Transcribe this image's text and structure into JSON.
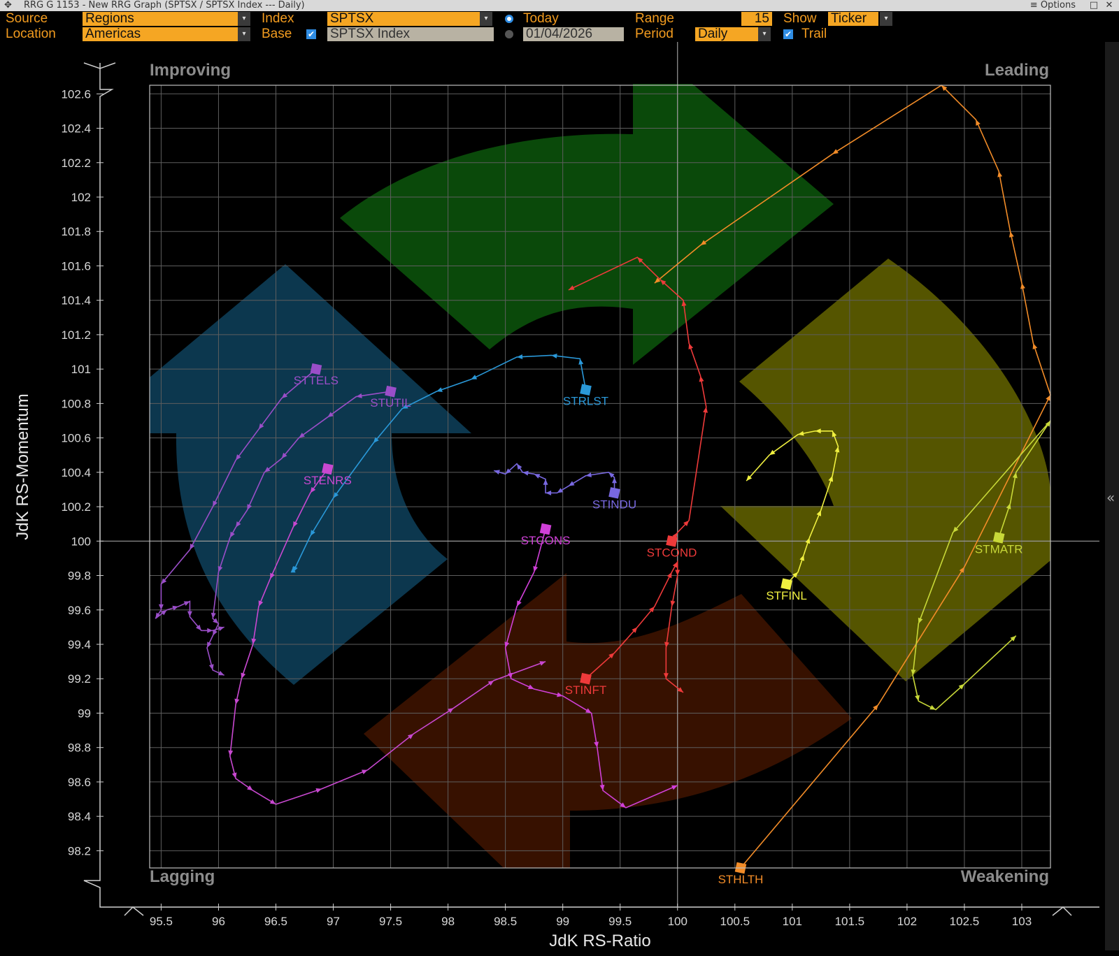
{
  "window": {
    "title": "RRG G 1153 - New RRG Graph (SPTSX / SPTSX Index --- Daily)",
    "options_label": "Options",
    "maximize_glyph": "□",
    "close_glyph": "✕"
  },
  "toolbar": {
    "source_label": "Source",
    "source_value": "Regions",
    "location_label": "Location",
    "location_value": "Americas",
    "index_label": "Index",
    "index_value": "SPTSX",
    "base_label": "Base",
    "base_value": "SPTSX Index",
    "today_label": "Today",
    "date_value": "01/04/2026",
    "range_label": "Range",
    "range_value": "15",
    "period_label": "Period",
    "period_value": "Daily",
    "show_label": "Show",
    "show_value": "Ticker",
    "trail_label": "Trail",
    "dropdown_glyph": "▾",
    "check_glyph": "✔"
  },
  "chart_data": {
    "type": "scatter",
    "xlabel": "JdK RS-Ratio",
    "ylabel": "JdK RS-Momentum",
    "xlim": [
      95.4,
      103.25
    ],
    "ylim": [
      98.1,
      102.65
    ],
    "center": [
      100,
      100
    ],
    "x_ticks": [
      95.5,
      96,
      96.5,
      97,
      97.5,
      98,
      98.5,
      99,
      99.5,
      100,
      100.5,
      101,
      101.5,
      102,
      102.5,
      103
    ],
    "x_tick_labels": [
      "95.5",
      "96",
      "96.5",
      "97",
      "97.5",
      "98",
      "98.5",
      "99",
      "99.5",
      "100",
      "100.5",
      "101",
      "101.5",
      "102",
      "102.5",
      "103"
    ],
    "y_ticks": [
      98.2,
      98.4,
      98.6,
      98.8,
      99,
      99.2,
      99.4,
      99.6,
      99.8,
      100,
      100.2,
      100.4,
      100.6,
      100.8,
      101,
      101.2,
      101.4,
      101.6,
      101.8,
      102,
      102.2,
      102.4,
      102.6
    ],
    "y_tick_labels": [
      "98.2",
      "98.4",
      "98.6",
      "98.8",
      "99",
      "99.2",
      "99.4",
      "99.6",
      "99.8",
      "100",
      "100.2",
      "100.4",
      "100.6",
      "100.8",
      "101",
      "101.2",
      "101.4",
      "101.6",
      "101.8",
      "102",
      "102.2",
      "102.4",
      "102.6"
    ],
    "quadrants": [
      "Improving",
      "Leading",
      "Lagging",
      "Weakening"
    ],
    "grid": true,
    "series": [
      {
        "name": "STHLTH",
        "color": "#f28c28",
        "points": [
          [
            100.55,
            98.1
          ],
          [
            101.75,
            99.05
          ],
          [
            102.5,
            99.85
          ],
          [
            103.25,
            100.85
          ],
          [
            103.1,
            101.15
          ],
          [
            103.0,
            101.5
          ],
          [
            102.9,
            101.8
          ],
          [
            102.8,
            102.15
          ],
          [
            102.6,
            102.45
          ],
          [
            102.3,
            102.65
          ],
          [
            101.35,
            102.25
          ],
          [
            100.2,
            101.72
          ],
          [
            99.8,
            101.5
          ]
        ]
      },
      {
        "name": "STMATR",
        "color": "#c8d838",
        "points": [
          [
            102.8,
            100.02
          ],
          [
            102.9,
            100.22
          ],
          [
            102.95,
            100.4
          ],
          [
            103.25,
            100.7
          ],
          [
            102.4,
            100.05
          ],
          [
            102.1,
            99.52
          ],
          [
            102.05,
            99.22
          ],
          [
            102.1,
            99.07
          ],
          [
            102.25,
            99.02
          ],
          [
            102.5,
            99.17
          ],
          [
            102.95,
            99.45
          ]
        ]
      },
      {
        "name": "STFINL",
        "color": "#f0f040",
        "points": [
          [
            100.95,
            99.75
          ],
          [
            101.05,
            99.82
          ],
          [
            101.1,
            99.92
          ],
          [
            101.15,
            100.02
          ],
          [
            101.25,
            100.18
          ],
          [
            101.35,
            100.38
          ],
          [
            101.4,
            100.55
          ],
          [
            101.35,
            100.64
          ],
          [
            101.2,
            100.64
          ],
          [
            101.05,
            100.62
          ],
          [
            100.8,
            100.5
          ],
          [
            100.6,
            100.35
          ]
        ]
      },
      {
        "name": "STCOND",
        "color": "#ee3a3a",
        "points": [
          [
            99.95,
            100.0
          ],
          [
            100.0,
            100.05
          ],
          [
            100.1,
            100.12
          ],
          [
            100.25,
            100.78
          ],
          [
            100.2,
            100.96
          ],
          [
            100.1,
            101.15
          ],
          [
            100.05,
            101.4
          ],
          [
            99.85,
            101.52
          ],
          [
            99.65,
            101.65
          ],
          [
            99.05,
            101.46
          ]
        ]
      },
      {
        "name": "STINFT",
        "color": "#ee3a3a",
        "points": [
          [
            99.2,
            99.2
          ],
          [
            99.45,
            99.35
          ],
          [
            99.65,
            99.5
          ],
          [
            99.8,
            99.62
          ],
          [
            99.95,
            99.82
          ],
          [
            100.0,
            99.88
          ],
          [
            100.0,
            99.8
          ],
          [
            99.95,
            99.62
          ],
          [
            99.9,
            99.38
          ],
          [
            99.9,
            99.2
          ],
          [
            100.05,
            99.12
          ]
        ]
      },
      {
        "name": "STINDU",
        "color": "#7868e0",
        "points": [
          [
            99.45,
            100.28
          ],
          [
            99.45,
            100.37
          ],
          [
            99.4,
            100.4
          ],
          [
            99.2,
            100.38
          ],
          [
            99.05,
            100.32
          ],
          [
            98.95,
            100.28
          ],
          [
            98.85,
            100.28
          ],
          [
            98.85,
            100.36
          ],
          [
            98.75,
            100.39
          ],
          [
            98.65,
            100.4
          ],
          [
            98.6,
            100.45
          ],
          [
            98.5,
            100.39
          ],
          [
            98.4,
            100.41
          ]
        ]
      },
      {
        "name": "STRLST",
        "color": "#2a98d8",
        "points": [
          [
            99.2,
            100.88
          ],
          [
            99.15,
            101.06
          ],
          [
            98.9,
            101.08
          ],
          [
            98.6,
            101.07
          ],
          [
            98.2,
            100.94
          ],
          [
            97.9,
            100.87
          ],
          [
            97.6,
            100.77
          ],
          [
            97.35,
            100.57
          ],
          [
            97.0,
            100.25
          ],
          [
            96.8,
            100.03
          ],
          [
            96.65,
            99.82
          ],
          [
            96.65,
            99.85
          ]
        ]
      },
      {
        "name": "STUTIL",
        "color": "#9a4ec8",
        "points": [
          [
            97.5,
            100.87
          ],
          [
            97.2,
            100.84
          ],
          [
            96.95,
            100.72
          ],
          [
            96.7,
            100.6
          ],
          [
            96.55,
            100.48
          ],
          [
            96.4,
            100.4
          ],
          [
            96.25,
            100.18
          ],
          [
            96.15,
            100.08
          ],
          [
            96.1,
            100.02
          ],
          [
            96.0,
            99.82
          ],
          [
            95.95,
            99.55
          ],
          [
            96.0,
            99.52
          ],
          [
            95.95,
            99.45
          ],
          [
            95.9,
            99.38
          ],
          [
            95.95,
            99.25
          ],
          [
            96.05,
            99.22
          ]
        ]
      },
      {
        "name": "STTELS",
        "color": "#9a4ec8",
        "points": [
          [
            96.85,
            101.0
          ],
          [
            96.55,
            100.83
          ],
          [
            96.35,
            100.65
          ],
          [
            96.15,
            100.47
          ],
          [
            95.95,
            100.2
          ],
          [
            95.75,
            99.95
          ],
          [
            95.5,
            99.75
          ],
          [
            95.5,
            99.6
          ],
          [
            95.45,
            99.55
          ],
          [
            95.55,
            99.6
          ],
          [
            95.65,
            99.62
          ],
          [
            95.75,
            99.65
          ],
          [
            95.75,
            99.56
          ],
          [
            95.85,
            99.48
          ],
          [
            95.95,
            99.48
          ],
          [
            96.05,
            99.5
          ]
        ]
      },
      {
        "name": "STENRS",
        "color": "#c848d0",
        "points": [
          [
            96.95,
            100.42
          ],
          [
            96.8,
            100.28
          ],
          [
            96.65,
            100.08
          ],
          [
            96.45,
            99.78
          ],
          [
            96.35,
            99.62
          ],
          [
            96.3,
            99.4
          ],
          [
            96.2,
            99.2
          ],
          [
            96.15,
            99.05
          ],
          [
            96.1,
            98.75
          ],
          [
            96.15,
            98.62
          ],
          [
            96.3,
            98.55
          ],
          [
            96.5,
            98.47
          ],
          [
            96.9,
            98.56
          ],
          [
            97.3,
            98.67
          ],
          [
            97.7,
            98.88
          ],
          [
            98.05,
            99.03
          ],
          [
            98.4,
            99.19
          ],
          [
            98.85,
            99.3
          ]
        ]
      },
      {
        "name": "STCONS",
        "color": "#d040d8",
        "points": [
          [
            98.85,
            100.07
          ],
          [
            98.75,
            99.82
          ],
          [
            98.6,
            99.62
          ],
          [
            98.5,
            99.38
          ],
          [
            98.55,
            99.2
          ],
          [
            98.75,
            99.14
          ],
          [
            99.0,
            99.1
          ],
          [
            99.25,
            99.0
          ],
          [
            99.3,
            98.8
          ],
          [
            99.35,
            98.55
          ],
          [
            99.55,
            98.45
          ],
          [
            100.0,
            98.58
          ]
        ]
      }
    ],
    "labels": [
      {
        "name": "STTELS",
        "color": "#9a4ec8"
      },
      {
        "name": "STUTIL",
        "color": "#9a4ec8"
      },
      {
        "name": "STENRS",
        "color": "#c848d0"
      },
      {
        "name": "STRLST",
        "color": "#2a98d8"
      },
      {
        "name": "STINDU",
        "color": "#7868e0"
      },
      {
        "name": "STCONS",
        "color": "#d040d8"
      },
      {
        "name": "STCOND",
        "color": "#ee3a3a"
      },
      {
        "name": "STINFT",
        "color": "#ee3a3a"
      },
      {
        "name": "STFINL",
        "color": "#f0f040"
      },
      {
        "name": "STMATR",
        "color": "#c8d838"
      },
      {
        "name": "STHLTH",
        "color": "#f28c28"
      }
    ]
  },
  "side_handle_glyph": "«"
}
